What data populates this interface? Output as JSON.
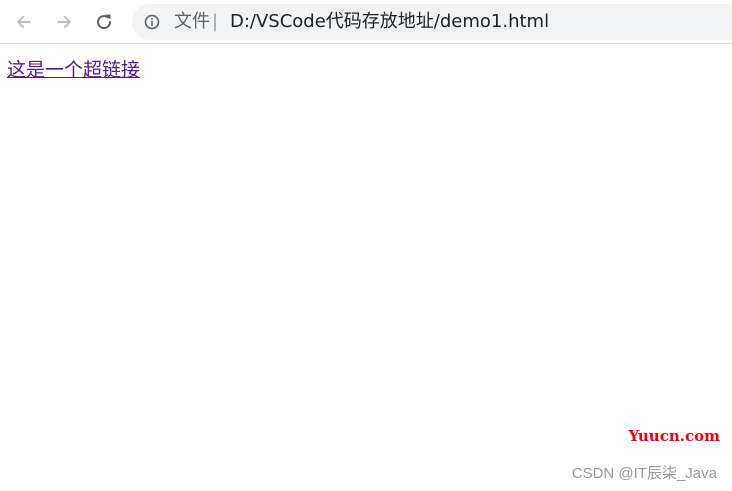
{
  "browser": {
    "omnibox": {
      "scheme_label": "文件",
      "separator": "|",
      "url": "D:/VSCode代码存放地址/demo1.html"
    },
    "icons": {
      "back": "arrow-left-icon",
      "forward": "arrow-right-icon",
      "reload": "reload-icon",
      "info": "info-icon"
    },
    "colors": {
      "omnibox_bg": "#f1f3f4",
      "visited_link": "#551a8b"
    }
  },
  "page": {
    "link_text": "这是一个超链接"
  },
  "watermarks": {
    "site": "Yuucn.com",
    "csdn": "CSDN @IT辰柒_Java"
  }
}
